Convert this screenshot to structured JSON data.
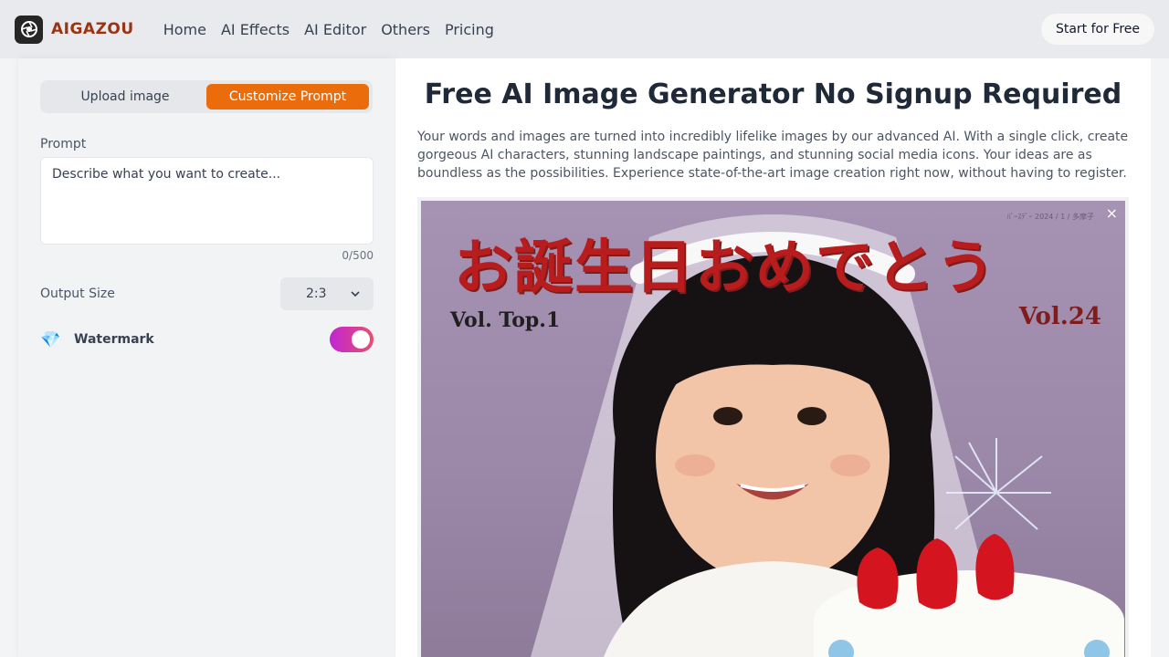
{
  "header": {
    "brand": "AIGAZOU",
    "nav": [
      "Home",
      "AI Effects",
      "AI Editor",
      "Others",
      "Pricing"
    ],
    "cta": "Start for Free"
  },
  "left_panel": {
    "tabs": [
      {
        "label": "Upload image",
        "active": false
      },
      {
        "label": "Customize Prompt",
        "active": true
      }
    ],
    "prompt_label": "Prompt",
    "prompt_placeholder": "Describe what you want to create...",
    "prompt_counter": "0/500",
    "output_size_label": "Output Size",
    "output_size_value": "2:3",
    "watermark_label": "Watermark",
    "watermark_on": true
  },
  "main": {
    "title": "Free AI Image Generator No Signup Required",
    "description": "Your words and images are turned into incredibly lifelike images by our advanced AI. With a single click, create gorgeous AI characters, stunning landscape paintings, and stunning social media icons. Your ideas are as boundless as the possibilities. Experience state-of-the-art image creation right now, without having to register.",
    "image": {
      "close_label": "×",
      "cover_title": "お誕生日おめでとう",
      "vol_left": "Vol. Top.1",
      "vol_right": "Vol.24"
    }
  },
  "colors": {
    "accent": "#ea6c0a",
    "brand_text": "#9a3412",
    "toggle_start": "#c026d3",
    "toggle_end": "#e84f6f"
  }
}
